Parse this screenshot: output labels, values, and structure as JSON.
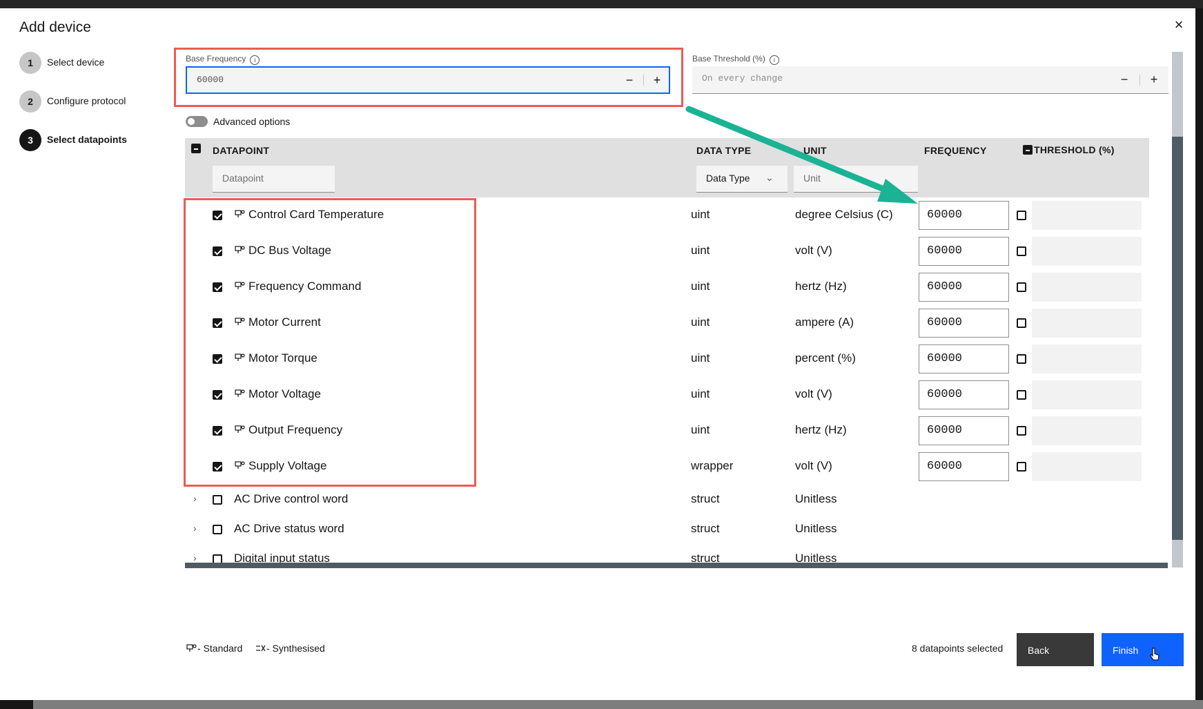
{
  "dialog": {
    "title": "Add device",
    "close_glyph": "×"
  },
  "steps": [
    {
      "number": "1",
      "label": "Select device"
    },
    {
      "number": "2",
      "label": "Configure protocol"
    },
    {
      "number": "3",
      "label": "Select datapoints"
    }
  ],
  "base_frequency": {
    "label": "Base Frequency",
    "value": "60000",
    "decrement": "−",
    "increment": "+"
  },
  "base_threshold": {
    "label": "Base Threshold (%)",
    "value": "On every change",
    "decrement": "−",
    "increment": "+"
  },
  "advanced_options": {
    "label": "Advanced options",
    "enabled": false
  },
  "table": {
    "headers": {
      "datapoint": "DATAPOINT",
      "data_type": "DATA TYPE",
      "unit": "UNIT",
      "frequency": "FREQUENCY",
      "threshold": "THRESHOLD (%)"
    },
    "filters": {
      "datapoint_placeholder": "Datapoint",
      "data_type_label": "Data Type",
      "unit_placeholder": "Unit"
    },
    "selected_rows": [
      {
        "name": "Control Card Temperature",
        "type": "uint",
        "unit": "degree Celsius (C)",
        "frequency": "60000"
      },
      {
        "name": "DC Bus Voltage",
        "type": "uint",
        "unit": "volt (V)",
        "frequency": "60000"
      },
      {
        "name": "Frequency Command",
        "type": "uint",
        "unit": "hertz (Hz)",
        "frequency": "60000"
      },
      {
        "name": "Motor Current",
        "type": "uint",
        "unit": "ampere (A)",
        "frequency": "60000"
      },
      {
        "name": "Motor Torque",
        "type": "uint",
        "unit": "percent (%)",
        "frequency": "60000"
      },
      {
        "name": "Motor Voltage",
        "type": "uint",
        "unit": "volt (V)",
        "frequency": "60000"
      },
      {
        "name": "Output Frequency",
        "type": "uint",
        "unit": "hertz (Hz)",
        "frequency": "60000"
      },
      {
        "name": "Supply Voltage",
        "type": "wrapper",
        "unit": "volt (V)",
        "frequency": "60000"
      }
    ],
    "struct_rows": [
      {
        "name": "AC Drive control word",
        "type": "struct",
        "unit": "Unitless"
      },
      {
        "name": "AC Drive status word",
        "type": "struct",
        "unit": "Unitless"
      },
      {
        "name": "Digital input status",
        "type": "struct",
        "unit": "Unitless"
      }
    ]
  },
  "legend": {
    "standard": "- Standard",
    "synthesised": "- Synthesised"
  },
  "footer": {
    "selection_count": "8 datapoints selected",
    "back_label": "Back",
    "finish_label": "Finish"
  },
  "colors": {
    "primary": "#0f62fe",
    "annotation_red": "#ec5b53",
    "annotation_teal": "#1ab394"
  }
}
